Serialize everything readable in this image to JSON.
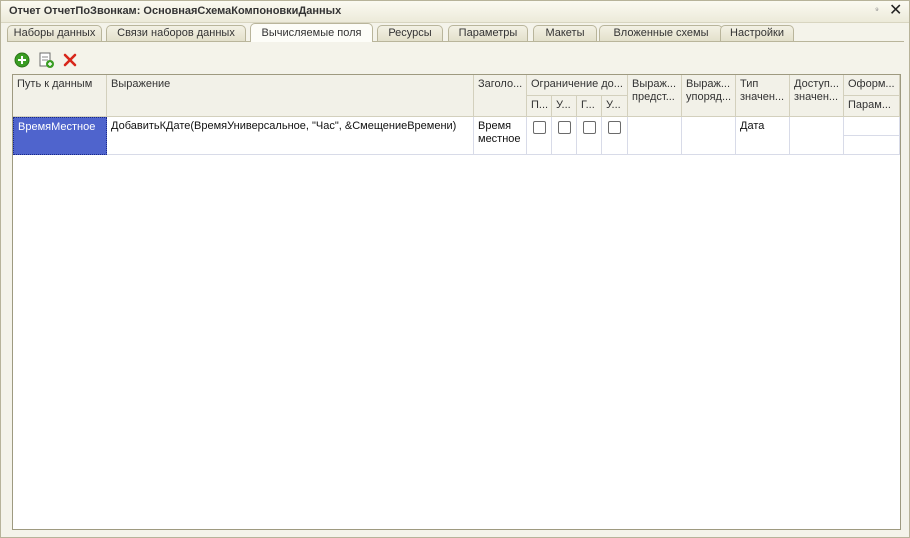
{
  "window": {
    "title": "Отчет ОтчетПоЗвонкам: ОсновнаяСхемаКомпоновкиДанных",
    "pin_label": "⁹",
    "close_label": "✕"
  },
  "tabs": [
    {
      "label": "Наборы данных"
    },
    {
      "label": "Связи наборов данных"
    },
    {
      "label": "Вычисляемые поля"
    },
    {
      "label": "Ресурсы"
    },
    {
      "label": "Параметры"
    },
    {
      "label": "Макеты"
    },
    {
      "label": "Вложенные схемы"
    },
    {
      "label": "Настройки"
    }
  ],
  "active_tab": "Вычисляемые поля",
  "toolbar": {
    "icons": [
      "add-icon",
      "copy-icon",
      "delete-icon"
    ],
    "colors": {
      "add": "#3a9d23",
      "delete": "#d8261b"
    }
  },
  "grid": {
    "headers": {
      "path": "Путь к данным",
      "expression": "Выражение",
      "title": "Заголо...",
      "restriction": "Ограничение до...",
      "restriction_sub": [
        "П...",
        "У...",
        "Г...",
        "У..."
      ],
      "expr_present": "Выраж... предст...",
      "expr_order": "Выраж... упоряд...",
      "type": "Тип значен...",
      "available": "Доступ... значен...",
      "format": "Оформ...",
      "format_sub": "Парам..."
    },
    "rows": [
      {
        "path": "ВремяМестное",
        "expression": "ДобавитьКДате(ВремяУниверсальное, \"Час\", &СмещениеВремени)",
        "title": "Время местное",
        "restrictions": [
          false,
          false,
          false,
          false
        ],
        "expr_present": "",
        "expr_order": "",
        "type": "Дата",
        "available": ""
      }
    ]
  }
}
